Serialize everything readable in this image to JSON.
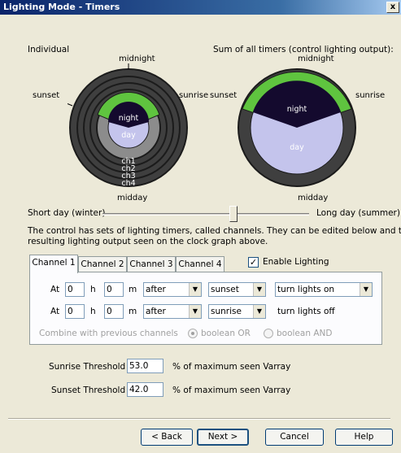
{
  "window": {
    "title": "Lighting Mode - Timers",
    "close_glyph": "x"
  },
  "clocks": {
    "individual_label": "Individual",
    "sum_label": "Sum of all timers (control lighting output):",
    "midnight": "midnight",
    "sunset": "sunset",
    "sunrise": "sunrise",
    "midday": "midday",
    "night": "night",
    "day": "day",
    "channels": [
      "ch1",
      "ch2",
      "ch3",
      "ch4"
    ],
    "colors": {
      "dark": "#3f3f3f",
      "ring": "#1b1b1b",
      "green": "#5fc43f",
      "night": "#140a2e",
      "day": "#c4c4ec",
      "gray": "#8c8c8c"
    }
  },
  "slider": {
    "left_label": "Short day (winter)",
    "right_label": "Long day (summer)",
    "value_fraction": 0.64
  },
  "description": {
    "line1": "The control has sets of lighting timers, called channels.  They can be edited below and the",
    "line2": "resulting  lighting output seen on the clock graph above."
  },
  "tabs": [
    "Channel 1",
    "Channel 2",
    "Channel 3",
    "Channel 4"
  ],
  "enable_lighting": {
    "label": "Enable Lighting",
    "checked": "✓"
  },
  "rows": [
    {
      "at": "At",
      "hours": "0",
      "h": "h",
      "minutes": "0",
      "m": "m",
      "relation": "after",
      "event": "sunset",
      "action": "turn lights on"
    },
    {
      "at": "At",
      "hours": "0",
      "h": "h",
      "minutes": "0",
      "m": "m",
      "relation": "after",
      "event": "sunrise",
      "action": "turn lights off"
    }
  ],
  "combine": {
    "label": "Combine with previous channels",
    "or_label": "boolean OR",
    "and_label": "boolean AND"
  },
  "thresholds": {
    "sunrise_label": "Sunrise Threshold",
    "sunrise_value": "53.0",
    "sunset_label": "Sunset Threshold",
    "sunset_value": "42.0",
    "unit": "% of maximum seen Varray"
  },
  "buttons": {
    "back": "< Back",
    "next": "Next >",
    "cancel": "Cancel",
    "help": "Help"
  }
}
